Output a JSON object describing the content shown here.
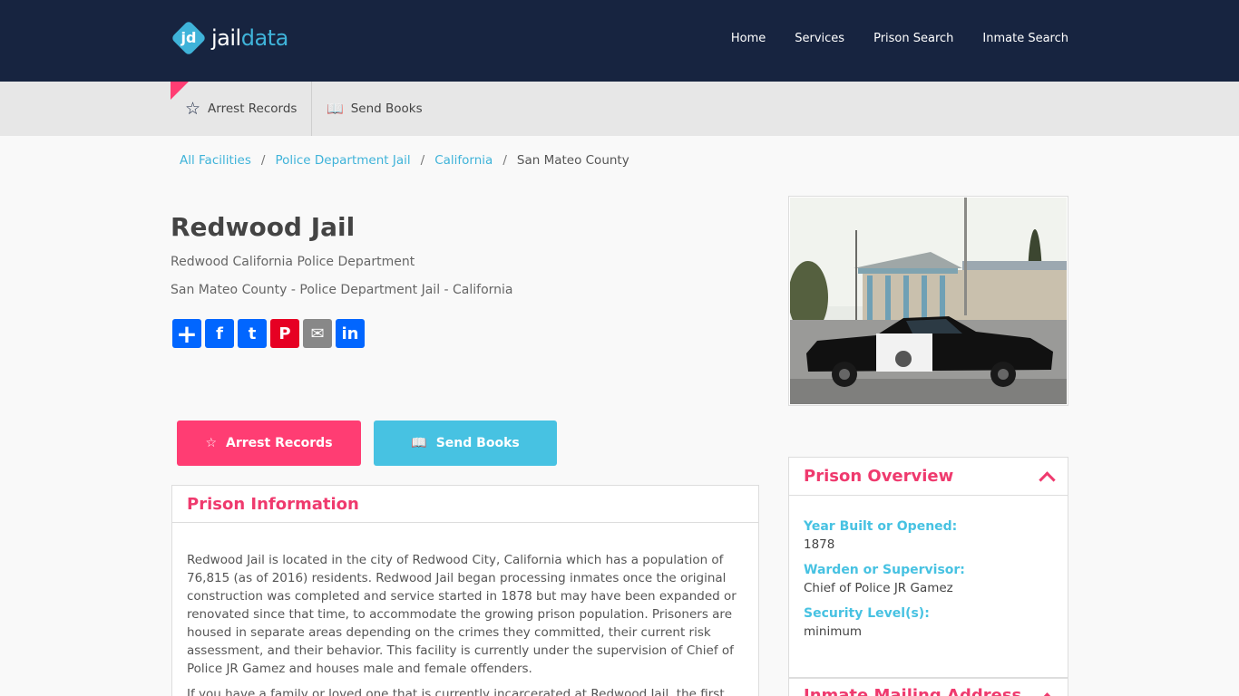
{
  "brand": {
    "logo_mark": "jd",
    "logo_part1": "jail",
    "logo_part2": "data"
  },
  "nav": [
    "Home",
    "Services",
    "Prison Search",
    "Inmate Search"
  ],
  "subnav": {
    "arrest_records": "Arrest Records",
    "send_books": "Send Books",
    "star_icon": "☆",
    "book_icon": "📖"
  },
  "breadcrumb": [
    "All Facilities",
    "Police Department Jail",
    "California",
    "San Mateo County"
  ],
  "title": "Redwood Jail",
  "subtitle1": "Redwood California Police Department",
  "subtitle2": "San Mateo County - Police Department Jail - California",
  "share_icons": [
    "+",
    "f",
    "t",
    "P",
    "✉",
    "in"
  ],
  "buttons": {
    "arrest_records": "Arrest Records",
    "send_books": "Send Books"
  },
  "info": {
    "heading": "Prison Information",
    "paragraph1": "Redwood Jail is located in the city of Redwood City, California which has a population of 76,815 (as of 2016) residents. Redwood Jail began processing inmates once the original construction was completed and service started in 1878 but may have been expanded or renovated since that time, to accommodate the growing prison population. Prisoners are housed in separate areas depending on the crimes they committed, their current risk assessment, and their behavior. This facility is currently under the supervision of Chief of Police JR Gamez and houses male and female offenders.",
    "paragraph2": "If you have a family or loved one that is currently incarcerated at Redwood Jail, the first thing"
  },
  "overview": {
    "heading": "Prison Overview",
    "year_label": "Year Built or Opened:",
    "year_value": "1878",
    "warden_label": "Warden or Supervisor:",
    "warden_value": "Chief of Police JR Gamez",
    "security_label": "Security Level(s):",
    "security_value": "minimum",
    "mailing_heading": "Inmate Mailing Address"
  },
  "colors": {
    "navy": "#172440",
    "pink": "#ff3d73",
    "blue": "#47c2e2"
  }
}
